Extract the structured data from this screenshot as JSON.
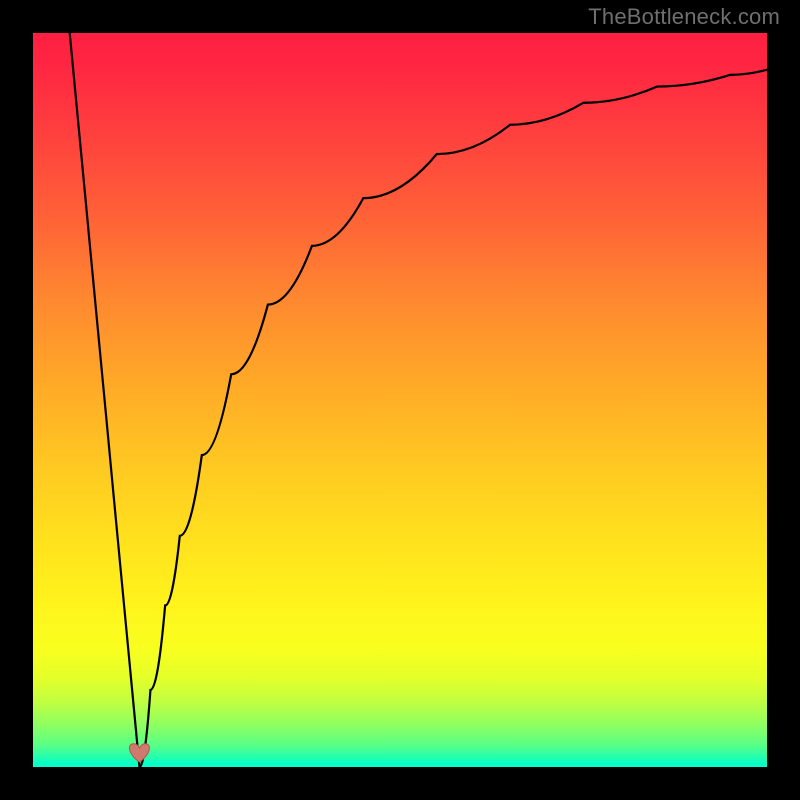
{
  "watermark": {
    "text": "TheBottleneck.com"
  },
  "chart_data": {
    "type": "line",
    "title": "",
    "xlabel": "",
    "ylabel": "",
    "xlim": [
      0,
      100
    ],
    "ylim": [
      0,
      100
    ],
    "grid": false,
    "legend": false,
    "background_gradient": [
      "#ff1f41",
      "#ff8730",
      "#fff41c",
      "#00ffd1"
    ],
    "curve_color": "#000000",
    "marker": {
      "shape": "heart",
      "color": "#d07a6f",
      "x": 14.5,
      "y": 1.5
    },
    "series": [
      {
        "name": "left-branch",
        "x": [
          5.0,
          6.0,
          7.0,
          8.0,
          9.0,
          10.0,
          11.0,
          12.0,
          13.0,
          14.0,
          14.5
        ],
        "y": [
          100.0,
          89.5,
          79.0,
          68.4,
          57.9,
          47.4,
          36.8,
          26.3,
          15.8,
          5.3,
          0.0
        ]
      },
      {
        "name": "right-branch",
        "x": [
          14.5,
          16,
          18,
          20,
          23,
          27,
          32,
          38,
          45,
          55,
          65,
          75,
          85,
          95,
          100
        ],
        "y": [
          0.0,
          10.5,
          22.0,
          31.5,
          42.5,
          53.5,
          63.0,
          71.0,
          77.5,
          83.5,
          87.5,
          90.5,
          92.7,
          94.3,
          95.0
        ]
      }
    ]
  }
}
